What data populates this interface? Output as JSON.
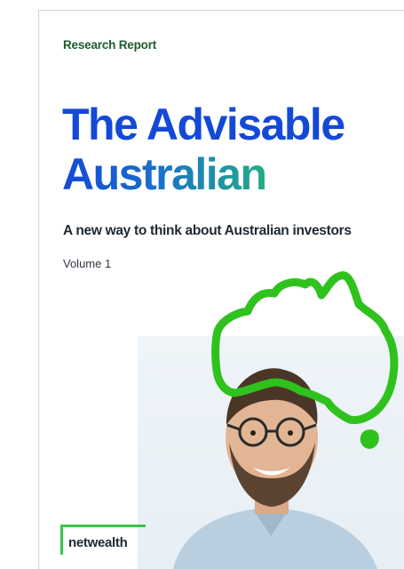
{
  "report": {
    "eyebrow": "Research Report",
    "title_line1": "The Advisable",
    "title_line2": "Australian",
    "subtitle": "A new way to think about Australian investors",
    "volume": "Volume 1"
  },
  "brand": {
    "logo_text": "netwealth"
  },
  "colors": {
    "title_blue": "#1449d8",
    "accent_green": "#3bc44b",
    "eyebrow_green": "#1d5c2c"
  },
  "images": {
    "australia_outline": "green hand-drawn outline of Australia map",
    "portrait": "smiling bearded man with glasses wearing a light blue shirt"
  }
}
